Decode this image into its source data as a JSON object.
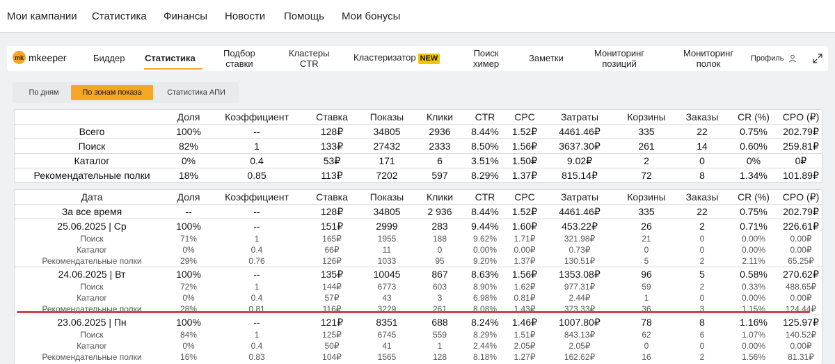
{
  "top_menu": [
    "Мои кампании",
    "Статистика",
    "Финансы",
    "Новости",
    "Помощь",
    "Мои бонусы"
  ],
  "logo": {
    "badge": "mk",
    "text": "mkeeper"
  },
  "nav": {
    "bidder": "Биддер",
    "stats": "Статистика",
    "bid_pick": [
      "Подбор",
      "ставки"
    ],
    "ctr_clusters": [
      "Кластеры",
      "CTR"
    ],
    "clusterizer": "Кластеризатор",
    "new_badge": "NEW",
    "chemist_search": [
      "Поиск",
      "химер"
    ],
    "notes": "Заметки",
    "pos_monitor": [
      "Мониторинг",
      "позиций"
    ],
    "shelf_monitor": [
      "Мониторинг",
      "полок"
    ],
    "profile": "Профиль"
  },
  "tabs": [
    "По дням",
    "По зонам показа",
    "Статистика АПИ"
  ],
  "active_tab": 1,
  "summary": {
    "headers": [
      "",
      "Доля",
      "Коэффициент",
      "Ставка",
      "Показы",
      "Клики",
      "CTR",
      "CPC",
      "Затраты",
      "Корзины",
      "Заказы",
      "CR (%)",
      "CPO (₽)"
    ],
    "rows": [
      [
        "Всего",
        "100%",
        "--",
        "128₽",
        "34805",
        "2936",
        "8.44%",
        "1.52₽",
        "4461.46₽",
        "335",
        "22",
        "0.75%",
        "202.79₽"
      ],
      [
        "Поиск",
        "82%",
        "1",
        "133₽",
        "27432",
        "2333",
        "8.50%",
        "1.56₽",
        "3637.30₽",
        "261",
        "14",
        "0.60%",
        "259.81₽"
      ],
      [
        "Каталог",
        "0%",
        "0.4",
        "53₽",
        "171",
        "6",
        "3.51%",
        "1.50₽",
        "9.02₽",
        "2",
        "0",
        "0%",
        "0₽"
      ],
      [
        "Рекомендательные полки",
        "18%",
        "0.85",
        "113₽",
        "7202",
        "597",
        "8.29%",
        "1.37₽",
        "815.14₽",
        "72",
        "8",
        "1.34%",
        "101.89₽"
      ]
    ]
  },
  "daily": {
    "headers": [
      "Дата",
      "Доля",
      "Коэффициент",
      "Ставка",
      "Показы",
      "Клики",
      "CTR",
      "CPC",
      "Затраты",
      "Корзины",
      "Заказы",
      "CR (%)",
      "CPO (₽)"
    ],
    "total": [
      "За все время",
      "--",
      "--",
      "128₽",
      "34805",
      "2 936",
      "8.44%",
      "1.52₽",
      "4461.46₽",
      "335",
      "22",
      "0.75%",
      "202.79₽"
    ],
    "days": [
      {
        "main": [
          "25.06.2025 | Ср",
          "100%",
          "--",
          "151₽",
          "2999",
          "283",
          "9.44%",
          "1.60₽",
          "453.22₽",
          "26",
          "2",
          "0.71%",
          "226.61₽"
        ],
        "subs": [
          [
            "Поиск",
            "71%",
            "1",
            "165₽",
            "1955",
            "188",
            "9.62%",
            "1.71₽",
            "321.98₽",
            "21",
            "0",
            "0.00%",
            "0.00₽"
          ],
          [
            "Каталог",
            "0%",
            "0.4",
            "66₽",
            "11",
            "0",
            "0.00%",
            "0.00₽",
            "0.73₽",
            "0",
            "0",
            "0.00%",
            "0.00₽"
          ],
          [
            "Рекомендательные полки",
            "29%",
            "0.76",
            "126₽",
            "1033",
            "95",
            "9.20%",
            "1.37₽",
            "130.51₽",
            "5",
            "2",
            "2.11%",
            "65.25₽"
          ]
        ]
      },
      {
        "main": [
          "24.06.2025 | Вт",
          "100%",
          "--",
          "135₽",
          "10045",
          "867",
          "8.63%",
          "1.56₽",
          "1353.08₽",
          "96",
          "5",
          "0.58%",
          "270.62₽"
        ],
        "subs": [
          [
            "Поиск",
            "72%",
            "1",
            "144₽",
            "6773",
            "603",
            "8.90%",
            "1.62₽",
            "977.31₽",
            "59",
            "2",
            "0.33%",
            "488.65₽"
          ],
          [
            "Каталог",
            "0%",
            "0.4",
            "57₽",
            "43",
            "3",
            "6.98%",
            "0.81₽",
            "2.44₽",
            "1",
            "0",
            "0.00%",
            "0.00₽"
          ],
          [
            "Рекомендательные полки",
            "28%",
            "0.81",
            "116₽",
            "3229",
            "261",
            "8.08%",
            "1.43₽",
            "373.33₽",
            "36",
            "3",
            "1.15%",
            "124.44₽"
          ]
        ]
      },
      {
        "main": [
          "23.06.2025 | Пн",
          "100%",
          "--",
          "121₽",
          "8351",
          "688",
          "8.24%",
          "1.46₽",
          "1007.80₽",
          "78",
          "8",
          "1.16%",
          "125.97₽"
        ],
        "subs": [
          [
            "Поиск",
            "84%",
            "1",
            "125₽",
            "6745",
            "559",
            "8.29%",
            "1.51₽",
            "843.13₽",
            "62",
            "6",
            "1.07%",
            "140.52₽"
          ],
          [
            "Каталог",
            "0%",
            "0.4",
            "50₽",
            "41",
            "1",
            "2.44%",
            "2.05₽",
            "2.05₽",
            "0",
            "0",
            "0.00%",
            "0.00₽"
          ],
          [
            "Рекомендательные полки",
            "16%",
            "0.83",
            "104₽",
            "1565",
            "128",
            "8.18%",
            "1.27₽",
            "162.62₽",
            "16",
            "2",
            "1.56%",
            "81.31₽"
          ]
        ]
      }
    ]
  },
  "colors": {
    "accent": "#f5a623",
    "new_badge": "#f5c400",
    "highlight_line": "#c74646"
  }
}
